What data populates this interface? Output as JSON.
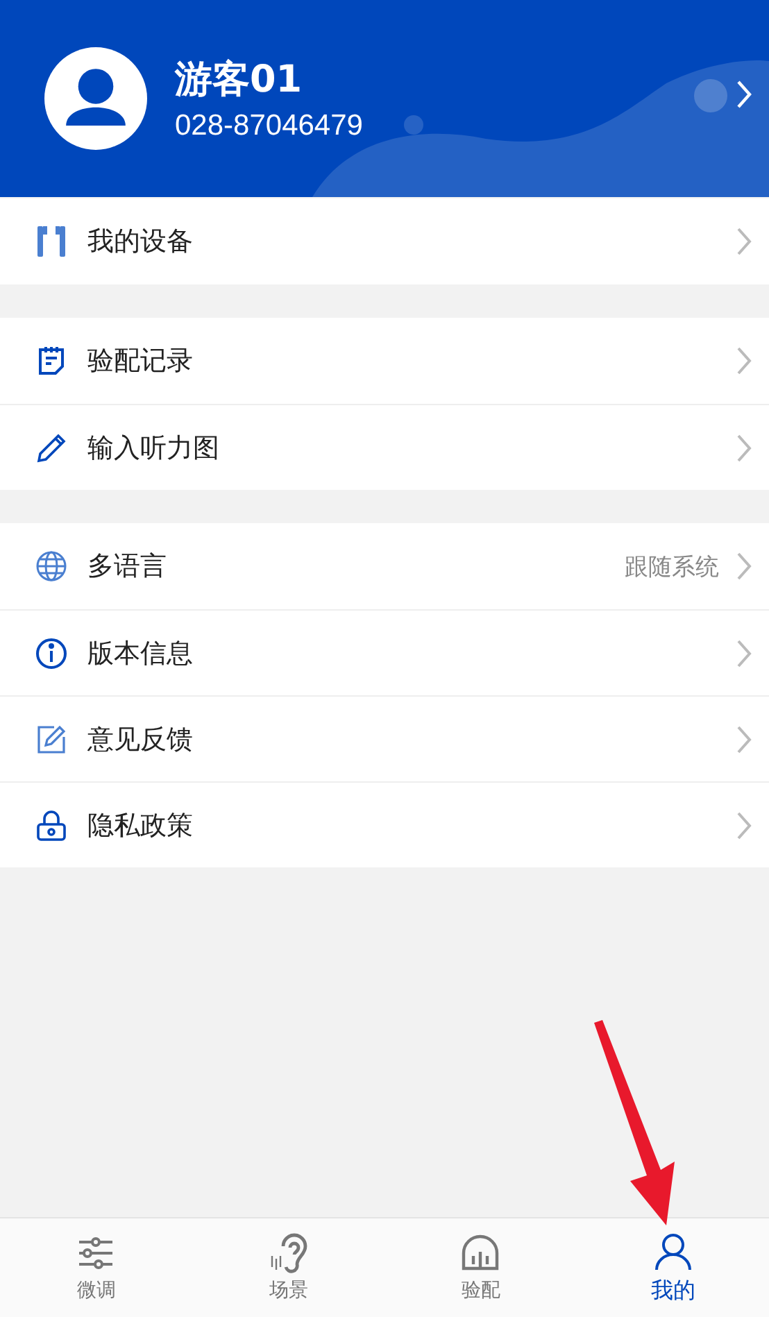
{
  "profile": {
    "name": "游客01",
    "phone": "028-87046479"
  },
  "sections": [
    {
      "items": [
        {
          "kind": "earphones",
          "label": "我的设备"
        }
      ]
    },
    {
      "items": [
        {
          "kind": "record",
          "label": "验配记录"
        },
        {
          "kind": "pen",
          "label": "输入听力图"
        }
      ]
    },
    {
      "items": [
        {
          "kind": "globe",
          "label": "多语言",
          "value": "跟随系统"
        },
        {
          "kind": "info",
          "label": "版本信息"
        },
        {
          "kind": "edit",
          "label": "意见反馈"
        },
        {
          "kind": "lock",
          "label": "隐私政策"
        }
      ]
    }
  ],
  "tabs": [
    {
      "kind": "sliders",
      "label": "微调",
      "selected": false
    },
    {
      "kind": "ear",
      "label": "场景",
      "selected": false
    },
    {
      "kind": "headphones",
      "label": "验配",
      "selected": false
    },
    {
      "kind": "person",
      "label": "我的",
      "selected": true
    }
  ]
}
